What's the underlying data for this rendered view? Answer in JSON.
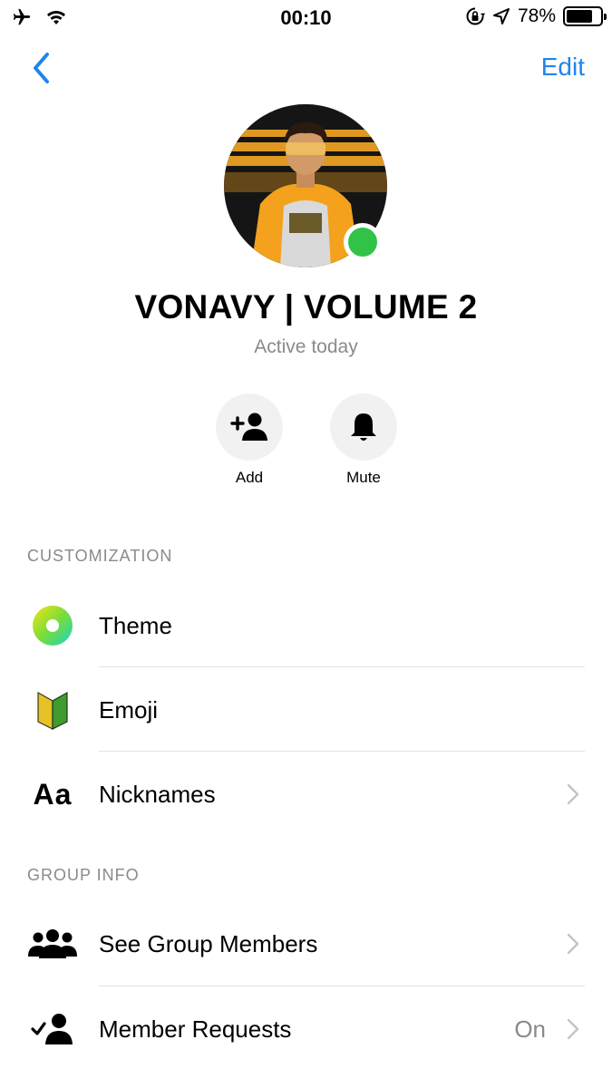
{
  "status_bar": {
    "time": "00:10",
    "battery_text": "78%",
    "battery_level": 0.78
  },
  "nav": {
    "back_icon": "chevron-left-icon",
    "edit_label": "Edit"
  },
  "group": {
    "name": "VONAVY | VOLUME 2",
    "status": "Active today"
  },
  "actions": [
    {
      "label": "Add",
      "icon": "add-person-icon"
    },
    {
      "label": "Mute",
      "icon": "bell-icon"
    }
  ],
  "customization": {
    "header": "CUSTOMIZATION",
    "items": [
      {
        "label": "Theme",
        "icon": "theme-icon"
      },
      {
        "label": "Emoji",
        "icon": "emoji-leaf-icon"
      },
      {
        "label": "Nicknames",
        "icon": "text-aa-icon",
        "icon_text": "Aa"
      }
    ]
  },
  "group_info": {
    "header": "GROUP INFO",
    "items": [
      {
        "label": "See Group Members",
        "icon": "people-icon"
      },
      {
        "label": "Member Requests",
        "icon": "member-check-icon",
        "value": "On"
      }
    ]
  },
  "colors": {
    "accent": "#1f84f0",
    "online": "#31c348",
    "secondary_text": "#8a8a8e"
  }
}
